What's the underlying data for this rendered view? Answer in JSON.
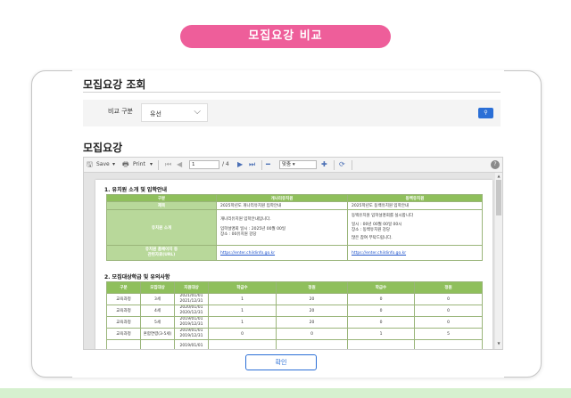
{
  "header_pill": "모집요강 비교",
  "modal": {
    "title": "모집요강 조회",
    "filter_label": "비교 구분",
    "filter_value": "유선",
    "search_icon": "search-icon",
    "section_title": "모집요강",
    "confirm_label": "확인"
  },
  "toolbar": {
    "save": "Save",
    "print": "Print",
    "page_current": "1",
    "page_total": "/ 4",
    "zoom": "맞춤"
  },
  "doc": {
    "section1_title": "1. 유치원 소개 및 입학안내",
    "table1": {
      "headers": [
        "구분",
        "개나리유치원",
        "동백유치원"
      ],
      "rows": [
        {
          "label": "제목",
          "a": "2025학년도 개나리유치원 입학안내",
          "b": "2025학년도 동백유치원 입학안내"
        },
        {
          "label": "유치원 소개",
          "a1": "개나리유치원 입학안내입니다.",
          "a2": "입학설명회 일시 : 2025년 00월 00일",
          "a3": "장소 : 00유치원 강당",
          "b1": "동백유치원 입학설명회를 실시합니다",
          "b2": "일시 : 00년 00월 00일 00시",
          "b3": "장소 : 동백유치원 강당",
          "b4": "많은 참여 부탁드립니다."
        },
        {
          "label1": "유치원 홈페이지 등",
          "label2": "관련자료(URL)",
          "a": "https://enter.childinfo.go.kr",
          "b": "https://enter.childinfo.go.kr"
        }
      ]
    },
    "section2_title": "2. 모집대상학급 및 유의사항",
    "table2": {
      "headers": [
        "구분",
        "모집대상",
        "지원대상",
        "학급수",
        "정원",
        "학급수",
        "정원"
      ],
      "rows": [
        {
          "c0": "교육과정",
          "c1": "3세",
          "d1": "2021/01/01",
          "d2": "2021/12/31",
          "c3": "1",
          "c4": "20",
          "c5": "0",
          "c6": "0"
        },
        {
          "c0": "교육과정",
          "c1": "4세",
          "d1": "2020/01/01",
          "d2": "2020/12/31",
          "c3": "1",
          "c4": "20",
          "c5": "0",
          "c6": "0"
        },
        {
          "c0": "교육과정",
          "c1": "5세",
          "d1": "2019/01/01",
          "d2": "2019/12/31",
          "c3": "1",
          "c4": "20",
          "c5": "0",
          "c6": "0"
        },
        {
          "c0": "교육과정",
          "c1": "혼합연령(3-5세)",
          "d1": "2019/01/01",
          "d2": "2019/12/31",
          "c3": "0",
          "c4": "0",
          "c5": "1",
          "c6": "5"
        },
        {
          "c0": "",
          "c1": "",
          "d1": "2019/01/01",
          "d2": "",
          "c3": "",
          "c4": "",
          "c5": "",
          "c6": ""
        }
      ]
    }
  }
}
